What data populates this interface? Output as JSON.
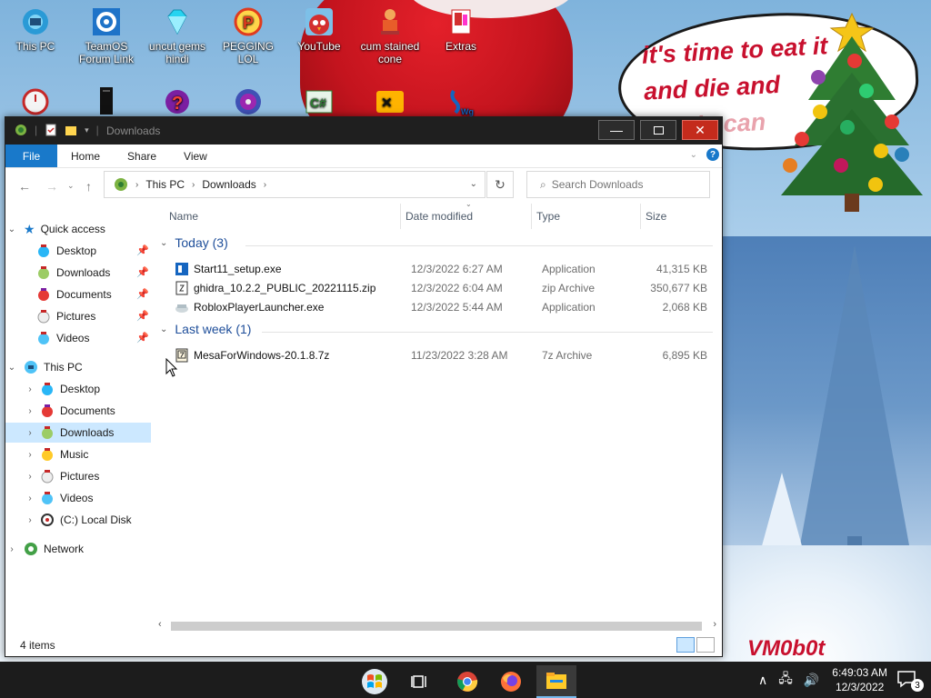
{
  "desktop": {
    "icons_row1": [
      {
        "label": "This PC",
        "icon": "this-pc-icon"
      },
      {
        "label": "TeamOS Forum Link",
        "icon": "gear-link-icon"
      },
      {
        "label": "uncut gems hindi",
        "icon": "diamond-icon"
      },
      {
        "label": "PEGGING LOL",
        "icon": "letter-p-icon"
      },
      {
        "label": "YouTube",
        "icon": "angry-bird-icon"
      },
      {
        "label": "cum stained cone",
        "icon": "cone-character-icon"
      },
      {
        "label": "Extras",
        "icon": "folder-extras-icon"
      }
    ],
    "icons_row2": [
      {
        "label": "",
        "icon": "clock-app-icon"
      },
      {
        "label": "",
        "icon": "black-tower-icon"
      },
      {
        "label": "",
        "icon": "question-mark-icon"
      },
      {
        "label": "",
        "icon": "disc-icon"
      },
      {
        "label": "",
        "icon": "csharp-icon"
      },
      {
        "label": "",
        "icon": "hd-x-icon"
      },
      {
        "label": "",
        "icon": "wg-script-icon"
      }
    ],
    "speech_bubble": {
      "line1": "it's time to eat it",
      "line2": "and die and",
      "line3": "candy can"
    },
    "watermark": "VM0b0t"
  },
  "window": {
    "title": "Downloads",
    "ribbon_tabs": [
      "File",
      "Home",
      "Share",
      "View"
    ],
    "help_label": "?",
    "address": {
      "crumbs": [
        "This PC",
        "Downloads"
      ]
    },
    "search": {
      "placeholder": "Search Downloads"
    },
    "nav": {
      "quick_access": "Quick access",
      "quick_items": [
        "Desktop",
        "Downloads",
        "Documents",
        "Pictures",
        "Videos"
      ],
      "this_pc": "This PC",
      "pc_items": [
        "Desktop",
        "Documents",
        "Downloads",
        "Music",
        "Pictures",
        "Videos",
        "(C:) Local Disk"
      ],
      "network": "Network"
    },
    "columns": {
      "name": "Name",
      "date": "Date modified",
      "type": "Type",
      "size": "Size"
    },
    "groups": [
      {
        "label": "Today (3)",
        "files": [
          {
            "name": "Start11_setup.exe",
            "date": "12/3/2022 6:27 AM",
            "type": "Application",
            "size": "41,315 KB",
            "icon": "start11-exe-icon"
          },
          {
            "name": "ghidra_10.2.2_PUBLIC_20221115.zip",
            "date": "12/3/2022 6:04 AM",
            "type": "zip Archive",
            "size": "350,677 KB",
            "icon": "zip-archive-icon"
          },
          {
            "name": "RobloxPlayerLauncher.exe",
            "date": "12/3/2022 5:44 AM",
            "type": "Application",
            "size": "2,068 KB",
            "icon": "roblox-exe-icon"
          }
        ]
      },
      {
        "label": "Last week (1)",
        "files": [
          {
            "name": "MesaForWindows-20.1.8.7z",
            "date": "11/23/2022 3:28 AM",
            "type": "7z Archive",
            "size": "6,895 KB",
            "icon": "7z-archive-icon"
          }
        ]
      }
    ],
    "status": "4 items"
  },
  "taskbar": {
    "items": [
      "start-button",
      "task-view",
      "chrome",
      "firefox",
      "file-explorer"
    ],
    "time": "6:49:03 AM",
    "date": "12/3/2022",
    "notifications": "3"
  },
  "colors": {
    "accent": "#1979ca",
    "selection": "#cce8ff",
    "titlebar": "#1f1f1f",
    "close": "#c42b1c",
    "group_header": "#1e4e9a",
    "speech_text": "#c8102e"
  }
}
